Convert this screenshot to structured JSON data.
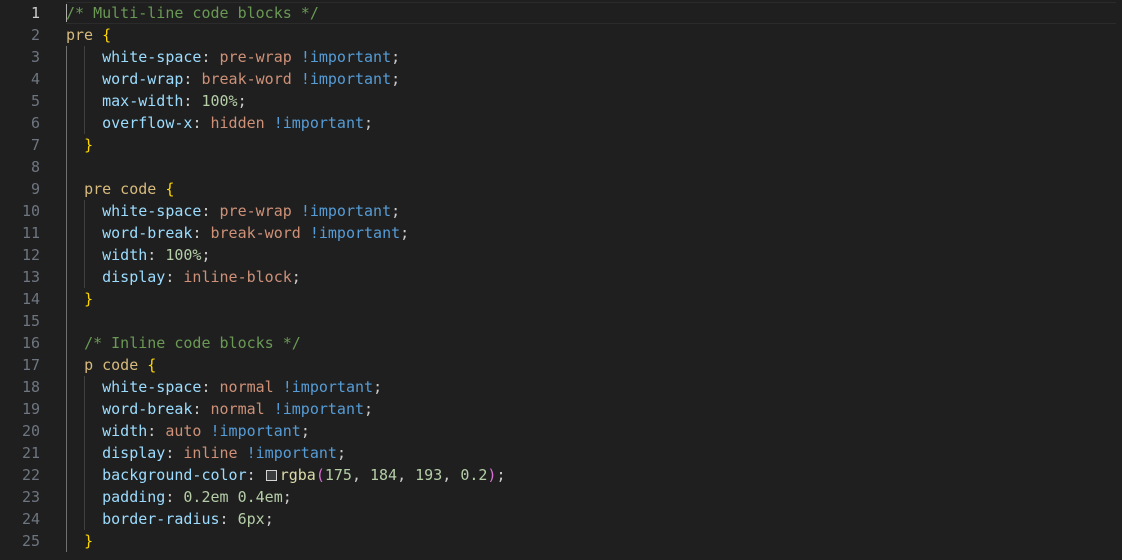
{
  "editor": {
    "current_line": 1,
    "line_numbers": [
      "1",
      "2",
      "3",
      "4",
      "5",
      "6",
      "7",
      "8",
      "9",
      "10",
      "11",
      "12",
      "13",
      "14",
      "15",
      "16",
      "17",
      "18",
      "19",
      "20",
      "21",
      "22",
      "23",
      "24",
      "25"
    ],
    "lines": [
      {
        "indent": "",
        "tokens": [
          {
            "t": "/* Multi-line code blocks */",
            "k": "cm"
          }
        ]
      },
      {
        "indent": "",
        "tokens": [
          {
            "t": "pre",
            "k": "sel"
          },
          {
            "t": " ",
            "k": ""
          },
          {
            "t": "{",
            "k": "br"
          }
        ]
      },
      {
        "indent": "    ",
        "tokens": [
          {
            "t": "white-space",
            "k": "prop"
          },
          {
            "t": ": ",
            "k": "pun"
          },
          {
            "t": "pre-wrap",
            "k": "val"
          },
          {
            "t": " ",
            "k": ""
          },
          {
            "t": "!important",
            "k": "imp"
          },
          {
            "t": ";",
            "k": "pun"
          }
        ]
      },
      {
        "indent": "    ",
        "tokens": [
          {
            "t": "word-wrap",
            "k": "prop"
          },
          {
            "t": ": ",
            "k": "pun"
          },
          {
            "t": "break-word",
            "k": "val"
          },
          {
            "t": " ",
            "k": ""
          },
          {
            "t": "!important",
            "k": "imp"
          },
          {
            "t": ";",
            "k": "pun"
          }
        ]
      },
      {
        "indent": "    ",
        "tokens": [
          {
            "t": "max-width",
            "k": "prop"
          },
          {
            "t": ": ",
            "k": "pun"
          },
          {
            "t": "100%",
            "k": "num"
          },
          {
            "t": ";",
            "k": "pun"
          }
        ]
      },
      {
        "indent": "    ",
        "tokens": [
          {
            "t": "overflow-x",
            "k": "prop"
          },
          {
            "t": ": ",
            "k": "pun"
          },
          {
            "t": "hidden",
            "k": "val"
          },
          {
            "t": " ",
            "k": ""
          },
          {
            "t": "!important",
            "k": "imp"
          },
          {
            "t": ";",
            "k": "pun"
          }
        ]
      },
      {
        "indent": "  ",
        "tokens": [
          {
            "t": "}",
            "k": "br"
          }
        ]
      },
      {
        "indent": "",
        "tokens": []
      },
      {
        "indent": "  ",
        "tokens": [
          {
            "t": "pre code",
            "k": "sel"
          },
          {
            "t": " ",
            "k": ""
          },
          {
            "t": "{",
            "k": "br"
          }
        ]
      },
      {
        "indent": "    ",
        "tokens": [
          {
            "t": "white-space",
            "k": "prop"
          },
          {
            "t": ": ",
            "k": "pun"
          },
          {
            "t": "pre-wrap",
            "k": "val"
          },
          {
            "t": " ",
            "k": ""
          },
          {
            "t": "!important",
            "k": "imp"
          },
          {
            "t": ";",
            "k": "pun"
          }
        ]
      },
      {
        "indent": "    ",
        "tokens": [
          {
            "t": "word-break",
            "k": "prop"
          },
          {
            "t": ": ",
            "k": "pun"
          },
          {
            "t": "break-word",
            "k": "val"
          },
          {
            "t": " ",
            "k": ""
          },
          {
            "t": "!important",
            "k": "imp"
          },
          {
            "t": ";",
            "k": "pun"
          }
        ]
      },
      {
        "indent": "    ",
        "tokens": [
          {
            "t": "width",
            "k": "prop"
          },
          {
            "t": ": ",
            "k": "pun"
          },
          {
            "t": "100%",
            "k": "num"
          },
          {
            "t": ";",
            "k": "pun"
          }
        ]
      },
      {
        "indent": "    ",
        "tokens": [
          {
            "t": "display",
            "k": "prop"
          },
          {
            "t": ": ",
            "k": "pun"
          },
          {
            "t": "inline-block",
            "k": "val"
          },
          {
            "t": ";",
            "k": "pun"
          }
        ]
      },
      {
        "indent": "  ",
        "tokens": [
          {
            "t": "}",
            "k": "br"
          }
        ]
      },
      {
        "indent": "",
        "tokens": []
      },
      {
        "indent": "  ",
        "tokens": [
          {
            "t": "/* Inline code blocks */",
            "k": "cm"
          }
        ]
      },
      {
        "indent": "  ",
        "tokens": [
          {
            "t": "p code",
            "k": "sel"
          },
          {
            "t": " ",
            "k": ""
          },
          {
            "t": "{",
            "k": "br"
          }
        ]
      },
      {
        "indent": "    ",
        "tokens": [
          {
            "t": "white-space",
            "k": "prop"
          },
          {
            "t": ": ",
            "k": "pun"
          },
          {
            "t": "normal",
            "k": "val"
          },
          {
            "t": " ",
            "k": ""
          },
          {
            "t": "!important",
            "k": "imp"
          },
          {
            "t": ";",
            "k": "pun"
          }
        ]
      },
      {
        "indent": "    ",
        "tokens": [
          {
            "t": "word-break",
            "k": "prop"
          },
          {
            "t": ": ",
            "k": "pun"
          },
          {
            "t": "normal",
            "k": "val"
          },
          {
            "t": " ",
            "k": ""
          },
          {
            "t": "!important",
            "k": "imp"
          },
          {
            "t": ";",
            "k": "pun"
          }
        ]
      },
      {
        "indent": "    ",
        "tokens": [
          {
            "t": "width",
            "k": "prop"
          },
          {
            "t": ": ",
            "k": "pun"
          },
          {
            "t": "auto",
            "k": "val"
          },
          {
            "t": " ",
            "k": ""
          },
          {
            "t": "!important",
            "k": "imp"
          },
          {
            "t": ";",
            "k": "pun"
          }
        ]
      },
      {
        "indent": "    ",
        "tokens": [
          {
            "t": "display",
            "k": "prop"
          },
          {
            "t": ": ",
            "k": "pun"
          },
          {
            "t": "inline",
            "k": "val"
          },
          {
            "t": " ",
            "k": ""
          },
          {
            "t": "!important",
            "k": "imp"
          },
          {
            "t": ";",
            "k": "pun"
          }
        ]
      },
      {
        "indent": "    ",
        "tokens": [
          {
            "t": "background-color",
            "k": "prop"
          },
          {
            "t": ": ",
            "k": "pun"
          },
          {
            "t": "",
            "k": "swatch"
          },
          {
            "t": "rgba",
            "k": "fn"
          },
          {
            "t": "(",
            "k": "br2"
          },
          {
            "t": "175",
            "k": "num"
          },
          {
            "t": ", ",
            "k": "pun"
          },
          {
            "t": "184",
            "k": "num"
          },
          {
            "t": ", ",
            "k": "pun"
          },
          {
            "t": "193",
            "k": "num"
          },
          {
            "t": ", ",
            "k": "pun"
          },
          {
            "t": "0.2",
            "k": "num"
          },
          {
            "t": ")",
            "k": "br2"
          },
          {
            "t": ";",
            "k": "pun"
          }
        ]
      },
      {
        "indent": "    ",
        "tokens": [
          {
            "t": "padding",
            "k": "prop"
          },
          {
            "t": ": ",
            "k": "pun"
          },
          {
            "t": "0.2em",
            "k": "num"
          },
          {
            "t": " ",
            "k": ""
          },
          {
            "t": "0.4em",
            "k": "num"
          },
          {
            "t": ";",
            "k": "pun"
          }
        ]
      },
      {
        "indent": "    ",
        "tokens": [
          {
            "t": "border-radius",
            "k": "prop"
          },
          {
            "t": ": ",
            "k": "pun"
          },
          {
            "t": "6px",
            "k": "num"
          },
          {
            "t": ";",
            "k": "pun"
          }
        ]
      },
      {
        "indent": "  ",
        "tokens": [
          {
            "t": "}",
            "k": "br"
          }
        ]
      }
    ]
  }
}
